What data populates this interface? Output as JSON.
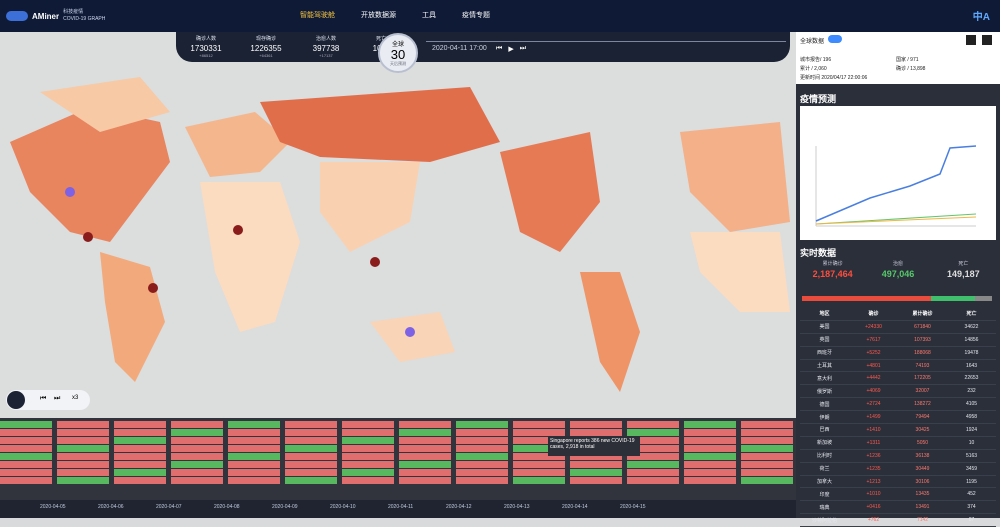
{
  "header": {
    "brand": "AMiner",
    "title1": "科技疫情",
    "title2": "COVID-19 GRAPH",
    "nav": [
      "智能驾驶舱",
      "开放数据源",
      "工具",
      "疫情专题"
    ],
    "lang": "中A"
  },
  "stats": [
    {
      "label": "确诊人数",
      "value": "1730331",
      "inc": "+86512"
    },
    {
      "label": "现存确诊",
      "value": "1226355",
      "inc": "+64361"
    },
    {
      "label": "治愈人数",
      "value": "397738",
      "inc": "+17137"
    },
    {
      "label": "死亡人数",
      "value": "106238",
      "inc": "+7550"
    }
  ],
  "globe": {
    "g1": "全球",
    "g2": "30",
    "g3": "天后预测"
  },
  "timeline": {
    "date": "2020-04-11 17:00"
  },
  "panel": {
    "toggle_label": "全球数据",
    "r1": "城市报告/ 196",
    "r2": "国家 / 971",
    "r3": "累计 / 2,060",
    "r4": "确诊 / 13,898",
    "r5": "更新时间 2020/04/17 22:00:06",
    "predict": "疫情预测",
    "realtime": "实时数据"
  },
  "realtime": {
    "col1": "累计确诊",
    "val1": "2,187,464",
    "col2": "治愈",
    "val2": "497,046",
    "col3": "死亡",
    "val3": "149,187"
  },
  "table": {
    "headers": [
      "地区",
      "确诊",
      "累计确诊",
      "死亡"
    ],
    "rows": [
      [
        "美国",
        "+24330",
        "671840",
        "34622"
      ],
      [
        "英国",
        "+7617",
        "107393",
        "14856"
      ],
      [
        "西班牙",
        "+5252",
        "188068",
        "19478"
      ],
      [
        "土耳其",
        "+4801",
        "74193",
        "1643"
      ],
      [
        "意大利",
        "+4442",
        "172205",
        "22653"
      ],
      [
        "俄罗斯",
        "+4069",
        "32007",
        "232"
      ],
      [
        "德国",
        "+2724",
        "138272",
        "4105"
      ],
      [
        "伊朗",
        "+1499",
        "79494",
        "4958"
      ],
      [
        "巴西",
        "+1410",
        "30425",
        "1924"
      ],
      [
        "新加坡",
        "+1311",
        "5050",
        "10"
      ],
      [
        "比利时",
        "+1236",
        "36138",
        "5163"
      ],
      [
        "荷兰",
        "+1235",
        "30449",
        "3459"
      ],
      [
        "加拿大",
        "+1213",
        "30106",
        "1195"
      ],
      [
        "印度",
        "+1010",
        "13435",
        "452"
      ],
      [
        "瑞典",
        "+0416",
        "13491",
        "374"
      ],
      [
        "沙特阿拉伯",
        "+762",
        "7142",
        "87"
      ]
    ]
  },
  "news": {
    "tooltip": "Singapore reports 386 new COVID-19 cases, 2,918 in total",
    "dates": [
      "2020-04-05",
      "2020-04-06",
      "2020-04-07",
      "2020-04-08",
      "2020-04-09",
      "2020-04-10",
      "2020-04-11",
      "2020-04-12",
      "2020-04-13",
      "2020-04-14",
      "2020-04-15"
    ]
  },
  "play": {
    "speed": "x3"
  }
}
